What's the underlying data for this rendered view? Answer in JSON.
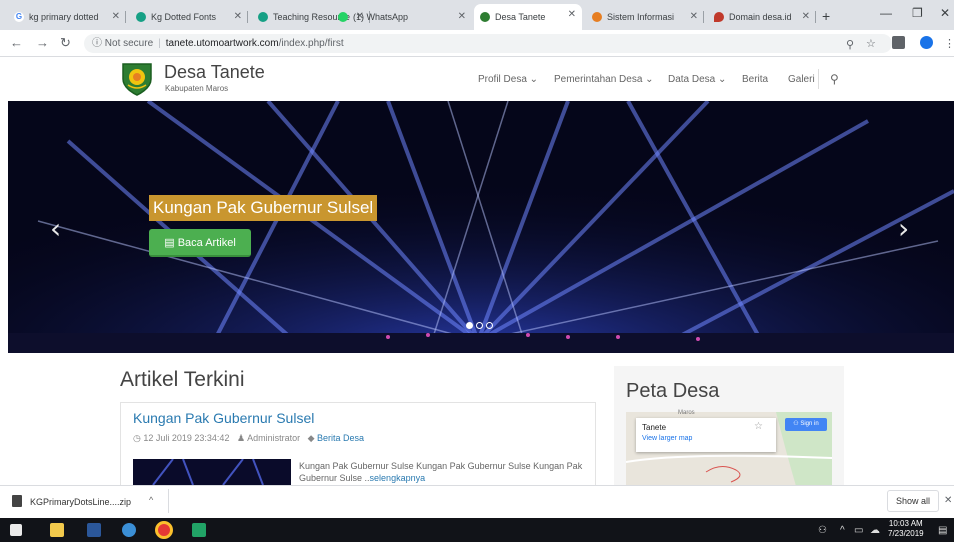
{
  "browser": {
    "tabs": [
      {
        "label": "kg primary dotted",
        "icon": "google-icon",
        "color": "#4285f4",
        "glyph": "G"
      },
      {
        "label": "Kg Dotted Fonts",
        "icon": "site-icon",
        "color": "#16a085",
        "glyph": ""
      },
      {
        "label": "Teaching Resource",
        "icon": "site-icon",
        "color": "#16a085",
        "glyph": ""
      },
      {
        "label": "(1) WhatsApp",
        "icon": "whatsapp-icon",
        "color": "#25d366",
        "glyph": ""
      },
      {
        "label": "Desa Tanete",
        "icon": "shield-icon",
        "color": "#2e7d32",
        "glyph": ""
      },
      {
        "label": "Sistem Informasi",
        "icon": "pinwheel-icon",
        "color": "#e67e22",
        "glyph": ""
      },
      {
        "label": "Domain desa.id",
        "icon": "pin-icon",
        "color": "#c0392b",
        "glyph": ""
      }
    ],
    "url": {
      "security": "Not secure",
      "host": "tanete.utomoartwork.com",
      "path": "/index.php/first"
    }
  },
  "site": {
    "title": "Desa Tanete",
    "subtitle": "Kabupaten Maros",
    "menu": [
      "Profil Desa ⌄",
      "Pemerintahan Desa ⌄",
      "Data Desa ⌄",
      "Berita",
      "Galeri"
    ]
  },
  "hero": {
    "title": "Kungan Pak Gubernur Sulsel",
    "button": "Baca Artikel",
    "slides": 3,
    "active_slide": 1
  },
  "articles": {
    "heading": "Artikel Terkini",
    "items": [
      {
        "title": "Kungan Pak Gubernur Sulsel",
        "date": "12 Juli 2019 23:34:42",
        "author": "Administrator",
        "category": "Berita Desa",
        "excerpt": "Kungan Pak Gubernur Sulse Kungan Pak Gubernur Sulse Kungan Pak Gubernur Sulse ..",
        "more": "selengkapnya"
      }
    ]
  },
  "sidebar": {
    "title": "Peta Desa",
    "map": {
      "place": "Tanete",
      "link": "View larger map",
      "signin": "Sign in",
      "label": "Maros"
    }
  },
  "downloads": {
    "file": "KGPrimaryDotsLine....zip",
    "show_all": "Show all"
  },
  "taskbar": {
    "time": "10:03 AM",
    "date": "7/23/2019"
  }
}
